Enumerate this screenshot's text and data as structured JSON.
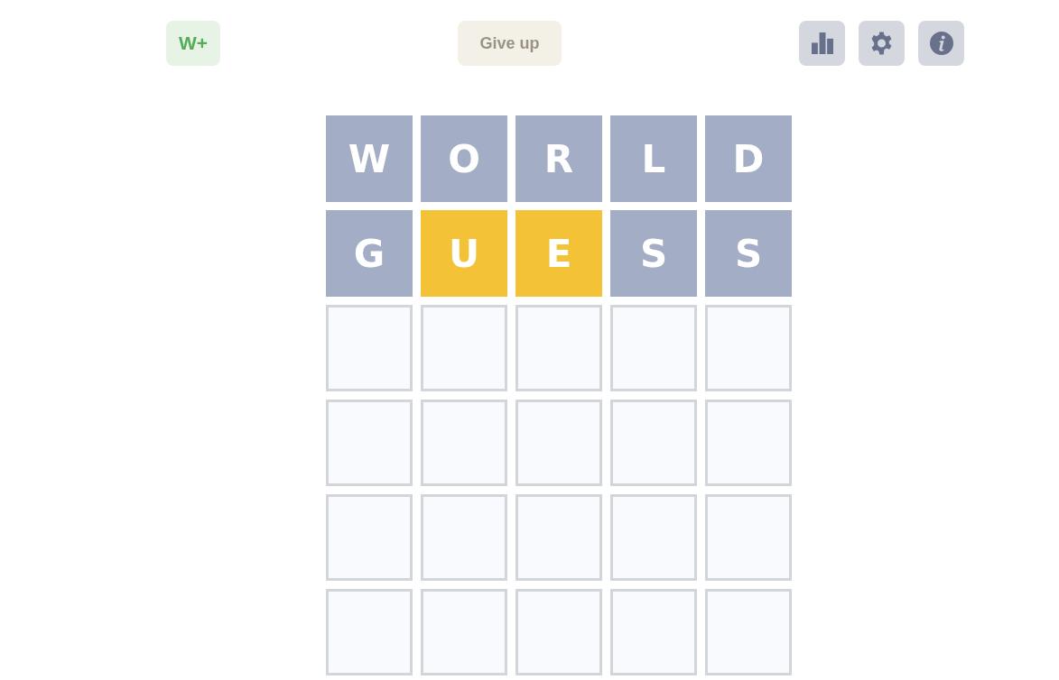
{
  "header": {
    "left_button": {
      "label": "W+"
    },
    "center_button": {
      "label": "Give up"
    },
    "icon_buttons": [
      {
        "kind": "stats"
      },
      {
        "kind": "settings"
      },
      {
        "kind": "info"
      }
    ]
  },
  "board": {
    "rows": [
      {
        "tiles": [
          {
            "letter": "W",
            "kind": "absent"
          },
          {
            "letter": "O",
            "kind": "absent"
          },
          {
            "letter": "R",
            "kind": "absent"
          },
          {
            "letter": "L",
            "kind": "absent"
          },
          {
            "letter": "D",
            "kind": "absent"
          }
        ]
      },
      {
        "tiles": [
          {
            "letter": "G",
            "kind": "absent"
          },
          {
            "letter": "U",
            "kind": "present"
          },
          {
            "letter": "E",
            "kind": "present"
          },
          {
            "letter": "S",
            "kind": "absent"
          },
          {
            "letter": "S",
            "kind": "absent"
          }
        ]
      },
      {
        "tiles": [
          {
            "kind": "empty"
          },
          {
            "kind": "empty"
          },
          {
            "kind": "empty"
          },
          {
            "kind": "empty"
          },
          {
            "kind": "empty"
          }
        ]
      },
      {
        "tiles": [
          {
            "kind": "empty"
          },
          {
            "kind": "empty"
          },
          {
            "kind": "empty"
          },
          {
            "kind": "empty"
          },
          {
            "kind": "empty"
          }
        ]
      },
      {
        "tiles": [
          {
            "kind": "empty"
          },
          {
            "kind": "empty"
          },
          {
            "kind": "empty"
          },
          {
            "kind": "empty"
          },
          {
            "kind": "empty"
          }
        ]
      },
      {
        "tiles": [
          {
            "kind": "empty"
          },
          {
            "kind": "empty"
          },
          {
            "kind": "empty"
          },
          {
            "kind": "empty"
          },
          {
            "kind": "empty"
          }
        ]
      }
    ]
  }
}
